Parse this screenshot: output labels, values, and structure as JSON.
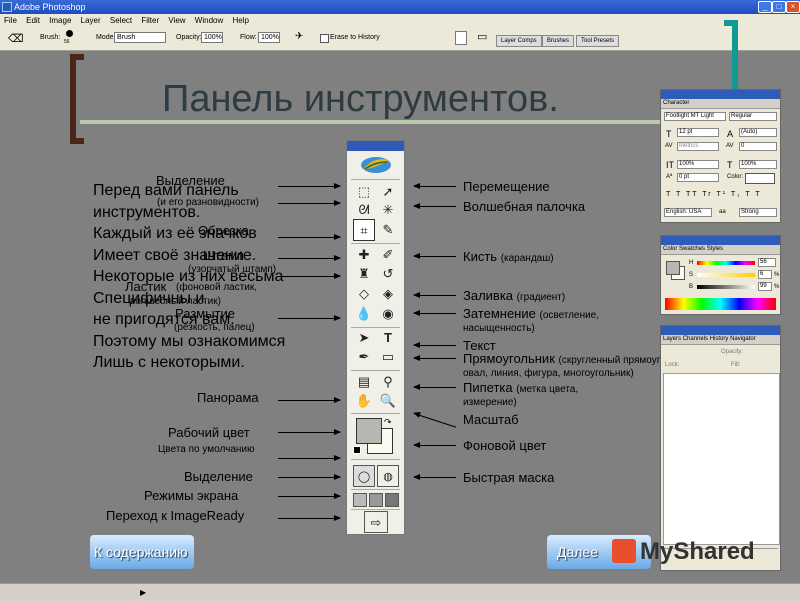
{
  "window": {
    "title": "Adobe Photoshop",
    "min": "_",
    "max": "□",
    "close": "×"
  },
  "menu": [
    "File",
    "Edit",
    "Image",
    "Layer",
    "Select",
    "Filter",
    "View",
    "Window",
    "Help"
  ],
  "options_bar": {
    "brush_label": "Brush:",
    "brush_size": "56",
    "mode_label": "Mode:",
    "mode_value": "Brush",
    "opacity_label": "Opacity:",
    "opacity_value": "100%",
    "flow_label": "Flow:",
    "flow_value": "100%",
    "erase_to_history": "Erase to History",
    "tabs": [
      "Layer Comps",
      "Brushes",
      "Tool Presets"
    ]
  },
  "slide": {
    "title": "Панель инструментов.",
    "body_lines": [
      "Перед вами панель",
      "инструментов.",
      "Каждый из её значков",
      "Имеет своё значение.",
      "Некоторые из них весьма",
      "Специфичны и",
      "не пригодятся вам.",
      "Поэтому мы ознакомимся",
      "Лишь с некоторыми."
    ],
    "left_labels": {
      "selection": "Выделение",
      "selection_sub": "(и его разновидности)",
      "crop": "Обрезка",
      "stamp": "Штамп",
      "stamp_sub": "(узорчатый штамп)",
      "eraser": "Ластик",
      "eraser_sub": "(фоновой ластик,",
      "eraser_sub2": "волшебный ластик)",
      "blur": "Размытие",
      "blur_sub": "(резкость, палец)",
      "pan": "Панорама",
      "work_color": "Рабочий цвет",
      "default_colors": "Цвета по умолчанию",
      "selection2": "Выделение",
      "screen_modes": "Режимы экрана",
      "imageready": "Переход к ImageReady"
    },
    "right_labels": {
      "move": "Перемещение",
      "magic_wand": "Волшебная палочка",
      "brush": "Кисть",
      "brush_sub": "(карандаш)",
      "fill": "Заливка",
      "fill_sub": "(градиент)",
      "dodge": "Затемнение",
      "dodge_sub": "(осветление,",
      "dodge_sub2": "насыщенность)",
      "text": "Текст",
      "rect": "Прямоугольник",
      "rect_sub": "(скругленный прямоугольник,",
      "rect_sub2": "овал, линия, фигура, многоугольник)",
      "eyedropper": "Пипетка",
      "eyedropper_sub": "(метка цвета,",
      "eyedropper_sub2": "измерение)",
      "zoom": "Масштаб",
      "bg_color": "Фоновой цвет",
      "quick_mask": "Быстрая маска"
    },
    "nav_prev": "К содержанию",
    "nav_next": "Далее",
    "watermark": "MyShared"
  },
  "character_panel": {
    "tab": "Character",
    "font": "Footlight MT Light",
    "style": "Regular",
    "size": "12 pt",
    "leading": "(Auto)",
    "kerning": "Metrics",
    "tracking": "0",
    "vscale": "100%",
    "hscale": "100%",
    "baseline": "0 pt",
    "color_label": "Color:",
    "style_buttons": [
      "T",
      "T",
      "TT",
      "Tr",
      "T¹",
      "T₁",
      "T",
      "T"
    ],
    "language": "English: USA",
    "aa": "Strong"
  },
  "color_panel": {
    "tabs": [
      "Color",
      "Swatches",
      "Styles"
    ],
    "h_label": "H",
    "h_value": "56",
    "s_label": "S",
    "s_value": "6",
    "s_unit": "%",
    "b_label": "B",
    "b_value": "99",
    "b_unit": "%",
    "accent": "#fcfbf0"
  },
  "layers_panel": {
    "tabs": [
      "Layers",
      "Channels",
      "History",
      "Navigator"
    ],
    "opacity_label": "Opacity:",
    "lock_label": "Lock:",
    "fill_label": "Fill:"
  }
}
